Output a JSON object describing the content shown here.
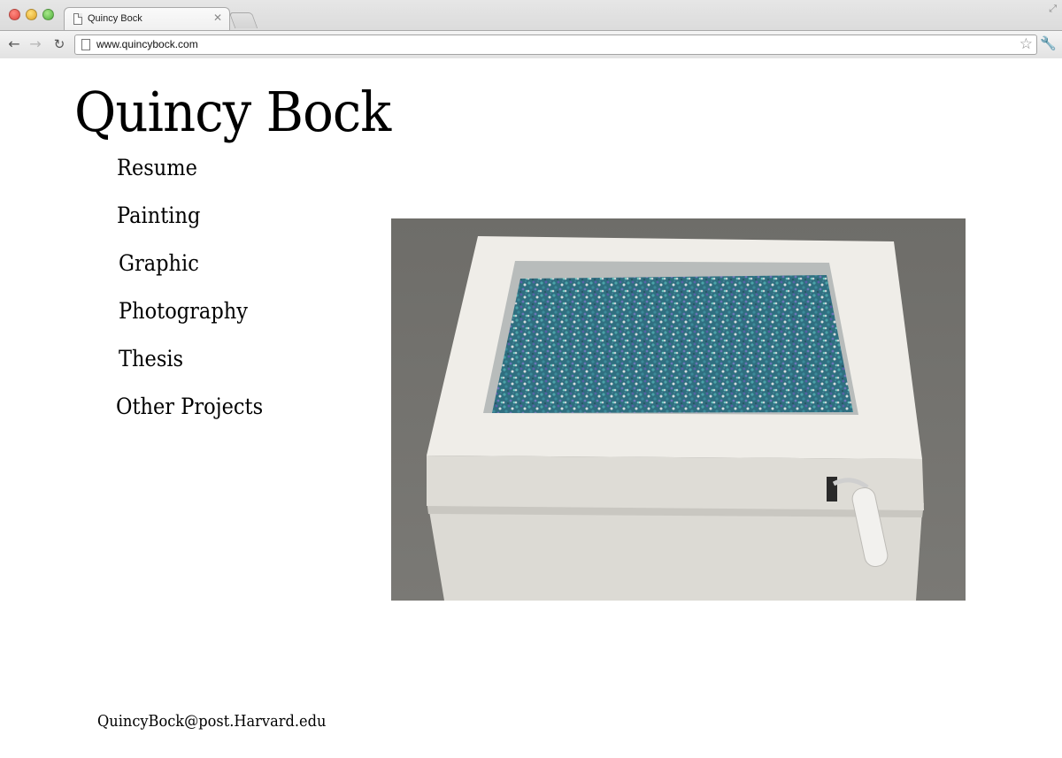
{
  "browser": {
    "tab_title": "Quincy Bock",
    "url": "www.quincybock.com"
  },
  "page": {
    "site_title": "Quincy Bock",
    "nav_items": [
      {
        "label": "Resume"
      },
      {
        "label": "Painting"
      },
      {
        "label": "Graphic"
      },
      {
        "label": "Photography"
      },
      {
        "label": "Thesis"
      },
      {
        "label": "Other Projects"
      }
    ],
    "email": "QuincyBock@post.Harvard.edu"
  },
  "icons": {
    "tab_close": "close-icon",
    "back": "back-arrow-icon",
    "forward": "forward-arrow-icon",
    "reload": "reload-icon",
    "bookmark": "star-icon",
    "settings": "wrench-icon"
  },
  "colors": {
    "page_background": "#ffffff",
    "text": "#000000",
    "photo_background": "#6d6c68"
  }
}
